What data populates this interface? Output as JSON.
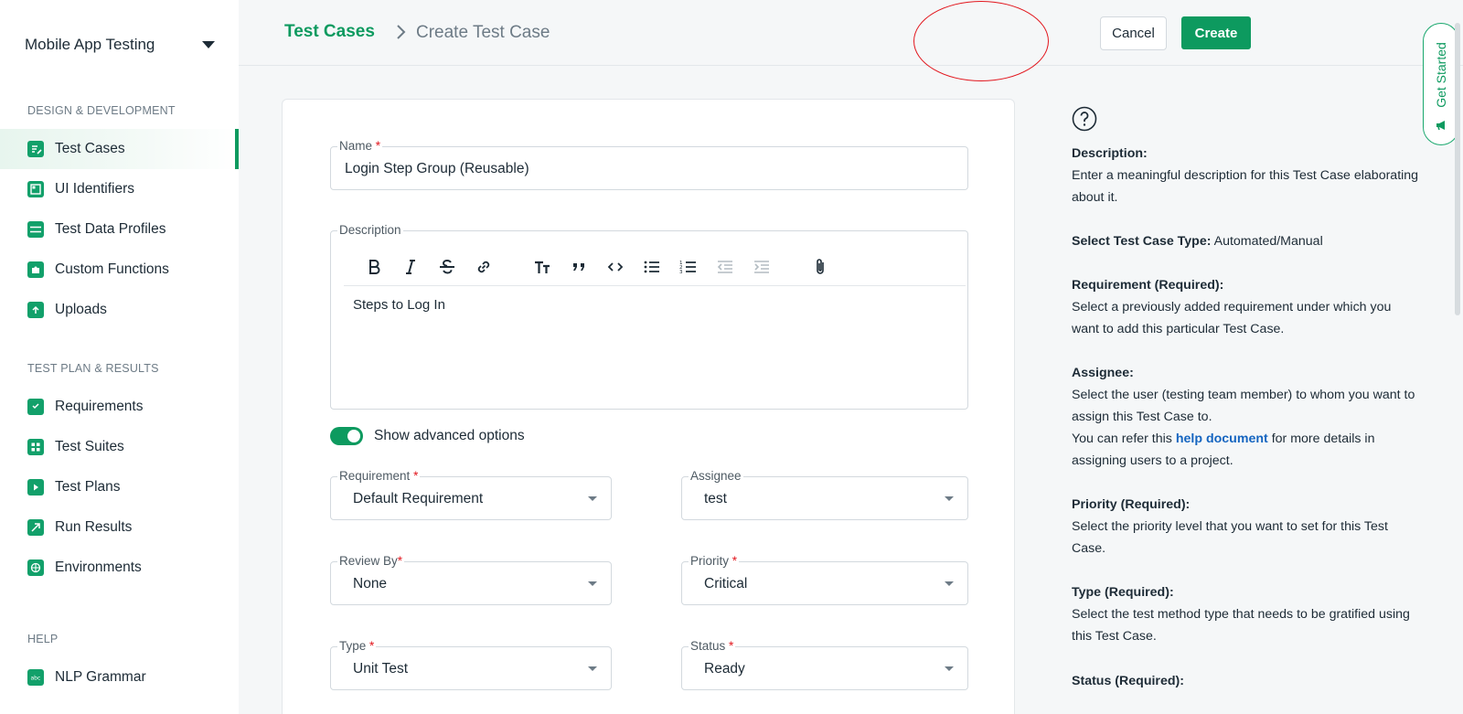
{
  "sidebar": {
    "project": "Mobile App Testing",
    "sections": [
      {
        "title": "DESIGN & DEVELOPMENT"
      },
      {
        "title": "TEST PLAN & RESULTS"
      },
      {
        "title": "HELP"
      }
    ],
    "items": [
      {
        "label": "Test Cases",
        "icon": "test-cases-icon",
        "active": true
      },
      {
        "label": "UI Identifiers",
        "icon": "ui-identifiers-icon"
      },
      {
        "label": "Test Data Profiles",
        "icon": "test-data-profiles-icon"
      },
      {
        "label": "Custom Functions",
        "icon": "puzzle-icon"
      },
      {
        "label": "Uploads",
        "icon": "upload-icon"
      },
      {
        "label": "Requirements",
        "icon": "clipboard-icon"
      },
      {
        "label": "Test Suites",
        "icon": "test-suites-icon"
      },
      {
        "label": "Test Plans",
        "icon": "play-icon"
      },
      {
        "label": "Run Results",
        "icon": "run-results-icon"
      },
      {
        "label": "Environments",
        "icon": "globe-icon"
      },
      {
        "label": "NLP Grammar",
        "icon": "abc-icon"
      }
    ]
  },
  "header": {
    "breadcrumb_root": "Test Cases",
    "breadcrumb_current": "Create Test Case",
    "cancel_label": "Cancel",
    "create_label": "Create"
  },
  "get_started": "Get Started",
  "form": {
    "name": {
      "label": "Name",
      "required": "*",
      "value": "Login Step Group (Reusable)"
    },
    "description": {
      "label": "Description",
      "value": "Steps to Log In",
      "toolbar": [
        "bold-icon",
        "italic-icon",
        "strikethrough-icon",
        "link-icon",
        "heading-icon",
        "quote-icon",
        "code-icon",
        "bullet-list-icon",
        "numbered-list-icon",
        "outdent-icon",
        "indent-icon",
        "attachment-icon"
      ]
    },
    "advanced_toggle": {
      "label": "Show advanced options",
      "on": true
    },
    "requirement": {
      "label": "Requirement",
      "required": "*",
      "value": "Default Requirement"
    },
    "assignee": {
      "label": "Assignee",
      "value": "test"
    },
    "review_by": {
      "label": "Review By",
      "required": "*",
      "value": "None"
    },
    "priority": {
      "label": "Priority",
      "required": "*",
      "value": "Critical"
    },
    "type": {
      "label": "Type",
      "required": "*",
      "value": "Unit Test"
    },
    "status": {
      "label": "Status",
      "required": "*",
      "value": "Ready"
    }
  },
  "help": {
    "description_title": "Description:",
    "description_text": "Enter a meaningful description for this Test Case elaborating about it.",
    "type_title": "Select Test Case Type:",
    "type_text": "Automated/Manual",
    "requirement_title": "Requirement (Required):",
    "requirement_text": "Select a previously added requirement under which you want to add this particular Test Case.",
    "assignee_title": "Assignee:",
    "assignee_text": "Select the user (testing team member) to whom you want to assign this Test Case to.",
    "assignee_refer_pre": "You can refer this",
    "assignee_link": "help document",
    "assignee_refer_post": "for more details in assigning users to a project.",
    "priority_title": "Priority (Required):",
    "priority_text": "Select the priority level that you want to set for this Test Case.",
    "typereq_title": "Type (Required):",
    "typereq_text": "Select the test method type that needs to be gratified using this Test Case.",
    "status_title": "Status (Required):"
  },
  "colors": {
    "brand_green": "#0d9a5f",
    "required_red": "#e2161d",
    "annotation_red": "#e2161d",
    "link_blue": "#1565c0"
  }
}
